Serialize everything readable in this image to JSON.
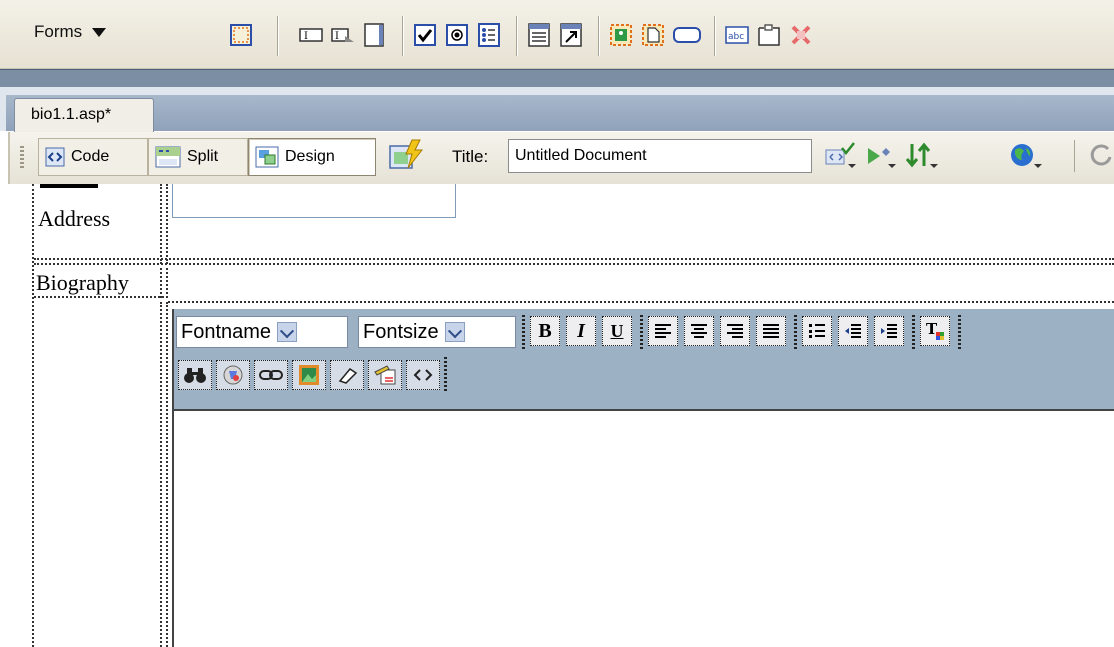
{
  "insert_bar": {
    "category": "Forms",
    "icons": [
      "form-icon",
      "text-field-icon",
      "hidden-field-icon",
      "textarea-icon",
      "checkbox-icon",
      "radio-button-icon",
      "radio-group-icon",
      "list-menu-icon",
      "jump-menu-icon",
      "image-field-icon",
      "file-field-icon",
      "button-icon",
      "label-icon",
      "fieldset-icon",
      "spry-validation-icon"
    ]
  },
  "document": {
    "tab_name": "bio1.1.asp*"
  },
  "doc_toolbar": {
    "code_label": "Code",
    "split_label": "Split",
    "design_label": "Design",
    "title_label": "Title:",
    "title_value": "Untitled Document"
  },
  "form": {
    "address_label": "Address",
    "biography_label": "Biography"
  },
  "editor": {
    "fontname_label": "Fontname",
    "fontsize_label": "Fontsize",
    "bold": "B",
    "italic": "I",
    "underline": "U"
  },
  "colors": {
    "editor_toolbar": "#9db1c4",
    "tab_strip": "#8fa2ba",
    "insert_bar": "#ece8dc"
  }
}
